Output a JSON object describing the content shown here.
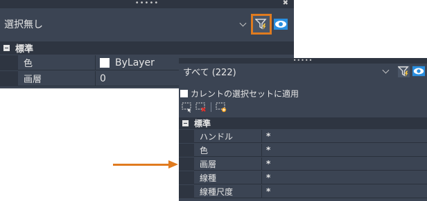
{
  "panel_main": {
    "grip_dots": "•••••",
    "close_glyph": "✖",
    "selection_value": "選択無し",
    "category_label": "標準",
    "properties": [
      {
        "name": "色",
        "value": "ByLayer",
        "swatch_color": "#ffffff"
      },
      {
        "name": "画層",
        "value": "0"
      }
    ]
  },
  "panel_overlay": {
    "grip_dots": "•••••",
    "selection_value": "すべて (222)",
    "apply_checkbox_label": "カレントの選択セットに適用",
    "category_label": "標準",
    "properties": [
      {
        "name": "ハンドル",
        "value": "*"
      },
      {
        "name": "色",
        "value": "*"
      },
      {
        "name": "画層",
        "value": "*"
      },
      {
        "name": "線種",
        "value": "*"
      },
      {
        "name": "線種尺度",
        "value": "*"
      }
    ]
  },
  "icons": {
    "quick_select_filter": "filter-lightning-icon",
    "toggle_pickadd": "eye-icon",
    "select_objects": "dashed-select-icon",
    "clear_selection": "clear-selection-icon",
    "add_to_selection": "add-selection-icon"
  },
  "colors": {
    "panel_bg": "#3b4453",
    "header_bg": "#2e3541",
    "highlight": "#e07b1f",
    "eye_blue": "#2a8fe0"
  }
}
